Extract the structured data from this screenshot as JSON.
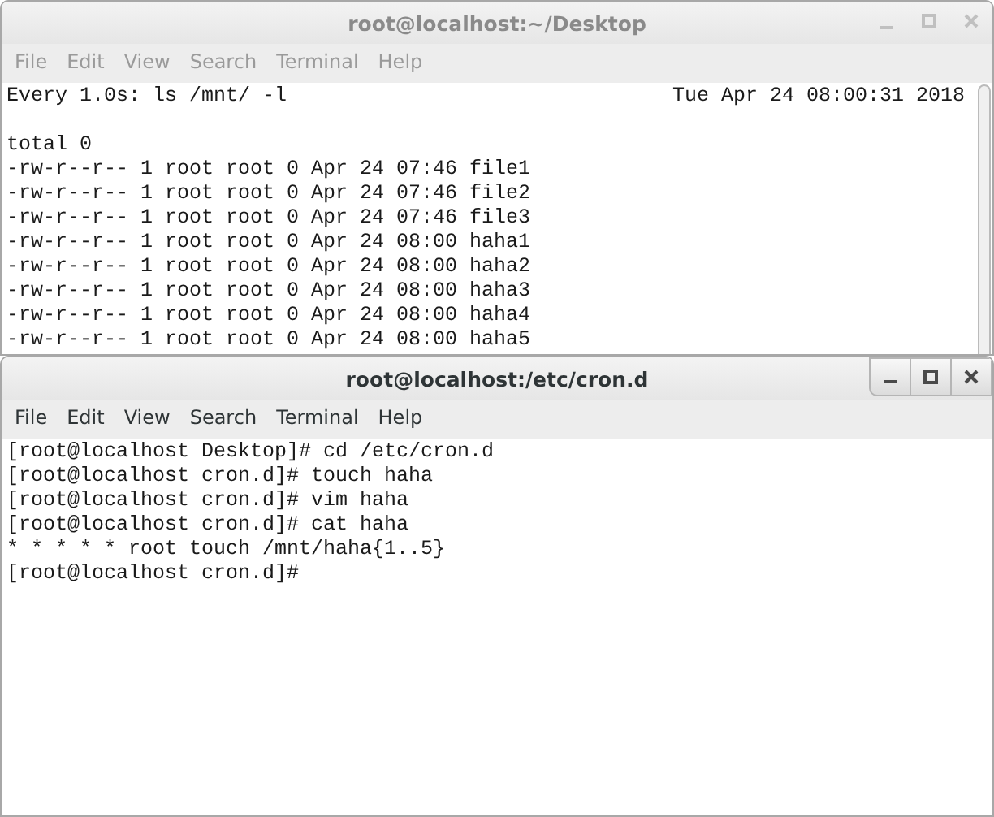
{
  "windows": [
    {
      "title": "root@localhost:~/Desktop",
      "active": false,
      "menu": [
        "File",
        "Edit",
        "View",
        "Search",
        "Terminal",
        "Help"
      ],
      "header": {
        "command": "Every 1.0s: ls /mnt/ -l",
        "time": "Tue Apr 24 08:00:31 2018"
      },
      "lines": [
        "total 0",
        "-rw-r--r-- 1 root root 0 Apr 24 07:46 file1",
        "-rw-r--r-- 1 root root 0 Apr 24 07:46 file2",
        "-rw-r--r-- 1 root root 0 Apr 24 07:46 file3",
        "-rw-r--r-- 1 root root 0 Apr 24 08:00 haha1",
        "-rw-r--r-- 1 root root 0 Apr 24 08:00 haha2",
        "-rw-r--r-- 1 root root 0 Apr 24 08:00 haha3",
        "-rw-r--r-- 1 root root 0 Apr 24 08:00 haha4",
        "-rw-r--r-- 1 root root 0 Apr 24 08:00 haha5"
      ]
    },
    {
      "title": "root@localhost:/etc/cron.d",
      "active": true,
      "menu": [
        "File",
        "Edit",
        "View",
        "Search",
        "Terminal",
        "Help"
      ],
      "lines": [
        "[root@localhost Desktop]# cd /etc/cron.d",
        "[root@localhost cron.d]# touch haha",
        "[root@localhost cron.d]# vim haha",
        "[root@localhost cron.d]# cat haha",
        "* * * * * root touch /mnt/haha{1..5}",
        "[root@localhost cron.d]#"
      ]
    }
  ]
}
